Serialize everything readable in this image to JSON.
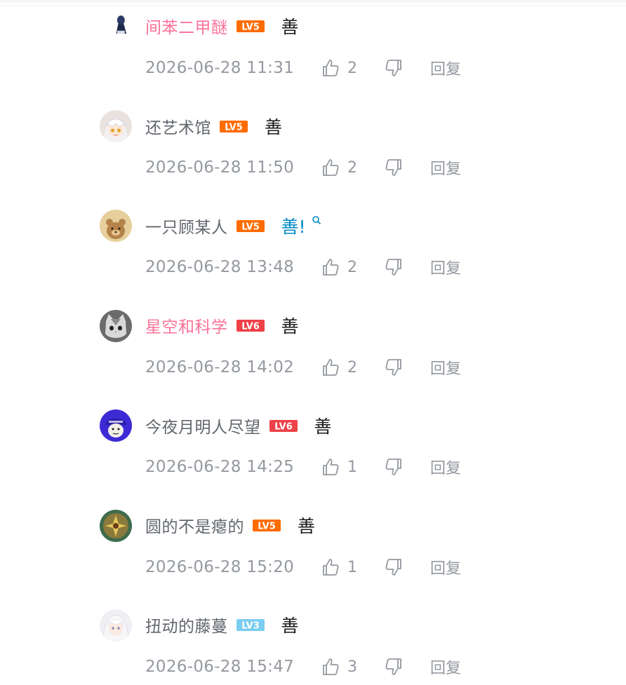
{
  "comments": [
    {
      "username": "间苯二甲醚",
      "vip": true,
      "level": "LV5",
      "level_color": "#ff6c00",
      "content": "善",
      "content_link": false,
      "time": "2026-06-28 11:31",
      "likes": "2",
      "reply": "回复",
      "avatar_icon": "figure-avatar-icon"
    },
    {
      "username": "还艺术馆",
      "vip": false,
      "level": "LV5",
      "level_color": "#ff6c00",
      "content": "善",
      "content_link": false,
      "time": "2026-06-28 11:50",
      "likes": "2",
      "reply": "回复",
      "avatar_icon": "anime-girl-avatar-icon"
    },
    {
      "username": "一只顾某人",
      "vip": false,
      "level": "LV5",
      "level_color": "#ff6c00",
      "content": "善!",
      "content_link": true,
      "time": "2026-06-28 13:48",
      "likes": "2",
      "reply": "回复",
      "avatar_icon": "bear-avatar-icon"
    },
    {
      "username": "星空和科学",
      "vip": true,
      "level": "LV6",
      "level_color": "#ee4148",
      "content": "善",
      "content_link": false,
      "time": "2026-06-28 14:02",
      "likes": "2",
      "reply": "回复",
      "avatar_icon": "cat-avatar-icon"
    },
    {
      "username": "今夜月明人尽望",
      "vip": false,
      "level": "LV6",
      "level_color": "#ee4148",
      "content": "善",
      "content_link": false,
      "time": "2026-06-28 14:25",
      "likes": "1",
      "reply": "回复",
      "avatar_icon": "meme-face-avatar-icon"
    },
    {
      "username": "圆的不是瘪的",
      "vip": false,
      "level": "LV5",
      "level_color": "#ff6c00",
      "content": "善",
      "content_link": false,
      "time": "2026-06-28 15:20",
      "likes": "1",
      "reply": "回复",
      "avatar_icon": "flower-avatar-icon"
    },
    {
      "username": "扭动的藤蔓",
      "vip": false,
      "level": "LV3",
      "level_color": "#7bcdef",
      "content": "善",
      "content_link": false,
      "time": "2026-06-28 15:47",
      "likes": "3",
      "reply": "回复",
      "avatar_icon": "white-hair-girl-avatar-icon"
    }
  ]
}
